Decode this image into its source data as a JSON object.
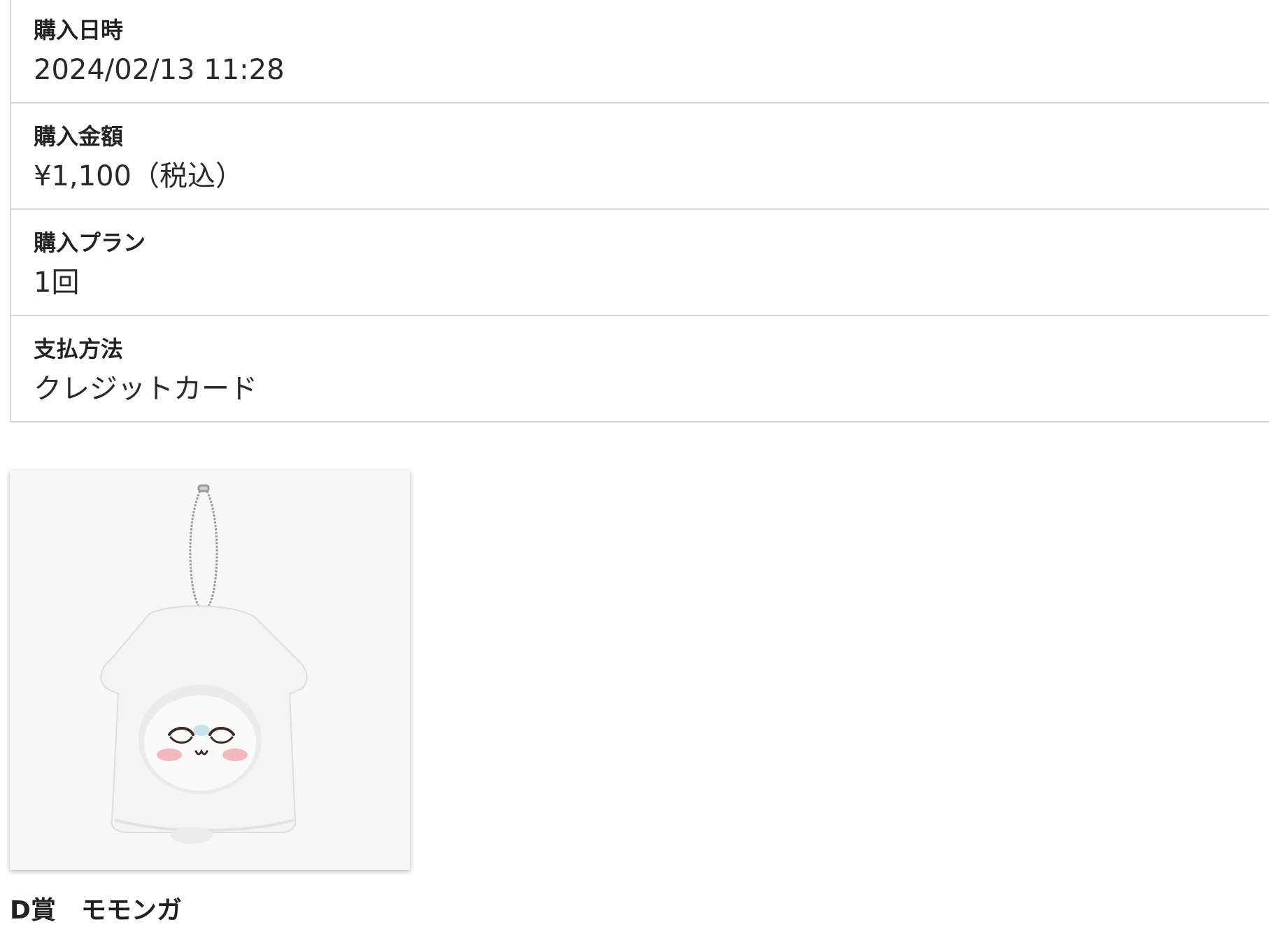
{
  "purchase": {
    "datetime_label": "購入日時",
    "datetime_value": "2024/02/13 11:28",
    "amount_label": "購入金額",
    "amount_value": "¥1,100（税込）",
    "plan_label": "購入プラン",
    "plan_value": "1回",
    "payment_label": "支払方法",
    "payment_value": "クレジットカード"
  },
  "product": {
    "image_icon": "plush-keychain-image",
    "prize_title": "D賞　モモンガ"
  }
}
